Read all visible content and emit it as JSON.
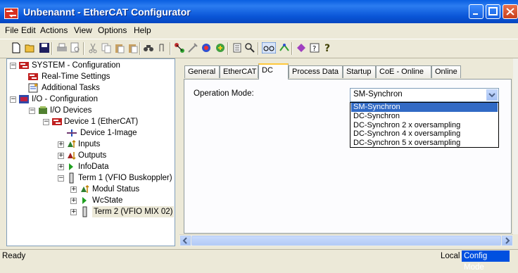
{
  "window": {
    "title": "Unbenannt - EtherCAT Configurator"
  },
  "menu": [
    "File",
    "Edit",
    "Actions",
    "View",
    "Options",
    "Help"
  ],
  "toolbar_icons": [
    "new-icon",
    "open-icon",
    "save-icon",
    "print-icon",
    "print-preview-icon",
    "cut-icon",
    "copy-icon",
    "paste-icon",
    "paste-special-icon",
    "binoculars-icon",
    "find-icon",
    "network-icon",
    "tools-icon",
    "target-icon",
    "activate-icon",
    "list-icon",
    "zoom-icon",
    "glasses-icon",
    "routing-icon",
    "install-icon",
    "help-icon",
    "whats-this-icon"
  ],
  "tree": {
    "system": "SYSTEM - Configuration",
    "realtime": "Real-Time Settings",
    "tasks": "Additional Tasks",
    "io": "I/O - Configuration",
    "io_devices": "I/O Devices",
    "device1": "Device 1 (EtherCAT)",
    "device1_image": "Device 1-Image",
    "inputs": "Inputs",
    "outputs": "Outputs",
    "infodata": "InfoData",
    "term1": "Term 1 (VFIO Buskoppler)",
    "modul_status": "Modul Status",
    "wcstate": "WcState",
    "term2": "Term 2 (VFIO MIX 02)"
  },
  "tabs": [
    "General",
    "EtherCAT",
    "DC",
    "Process Data",
    "Startup",
    "CoE - Online",
    "Online"
  ],
  "active_tab": "DC",
  "dc": {
    "op_mode_label": "Operation Mode:",
    "op_mode_value": "SM-Synchron",
    "options": [
      "SM-Synchron",
      "DC-Synchron",
      "DC-Synchron 2 x oversampling",
      "DC-Synchron 4 x oversampling",
      "DC-Synchron 5 x oversampling"
    ]
  },
  "status": {
    "ready": "Ready",
    "local": "Local",
    "mode": "Config Mode"
  },
  "colors": {
    "title_blue": "#0a56d8",
    "selection": "#316ac5",
    "status_mode_bg": "#0050e0"
  }
}
